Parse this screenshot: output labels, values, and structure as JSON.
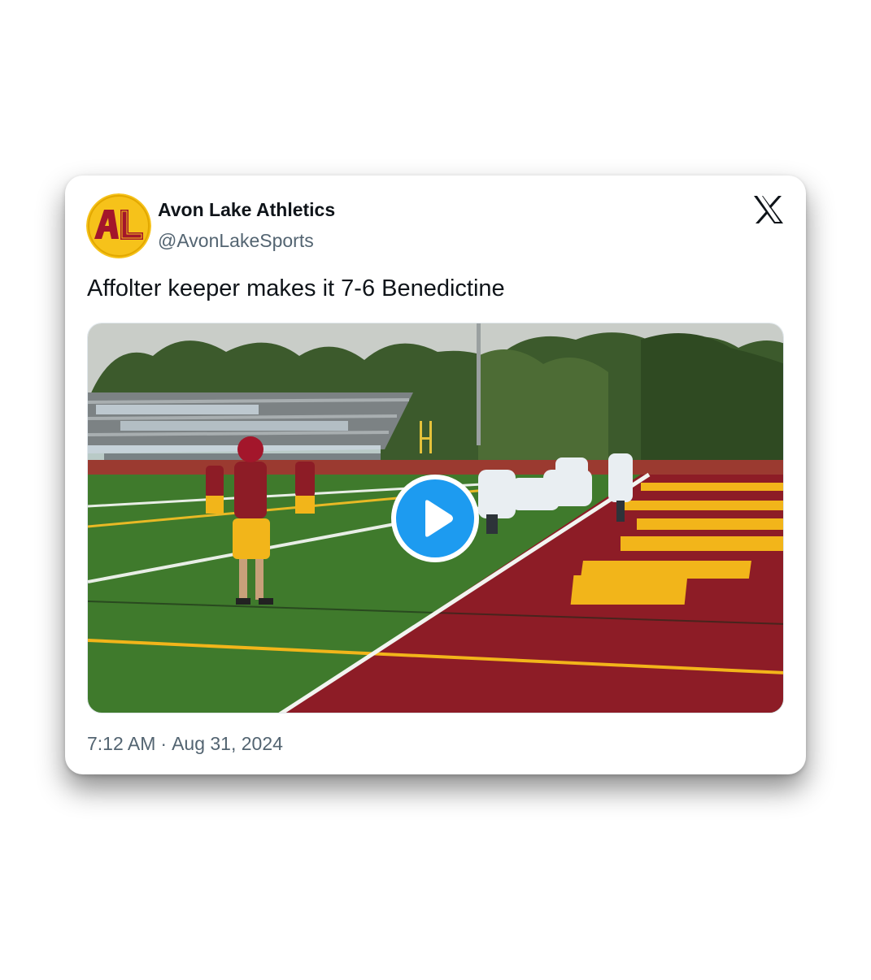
{
  "author": {
    "display_name": "Avon Lake Athletics",
    "handle": "@AvonLakeSports",
    "avatar_text": "AL"
  },
  "brand_icon": "x-logo-icon",
  "tweet": {
    "text": "Affolter keeper makes it 7-6 Benedictine"
  },
  "media": {
    "type": "video",
    "play_icon": "play-icon"
  },
  "timestamp": {
    "time": "7:12 AM",
    "separator": "·",
    "date": "Aug 31, 2024"
  },
  "colors": {
    "play_button": "#1d9bf0",
    "avatar_gold": "#f6c21a",
    "avatar_maroon": "#a3162b",
    "endzone_maroon": "#8d1c26",
    "endzone_gold": "#f2b51a",
    "turf_green": "#3f7a2c"
  }
}
